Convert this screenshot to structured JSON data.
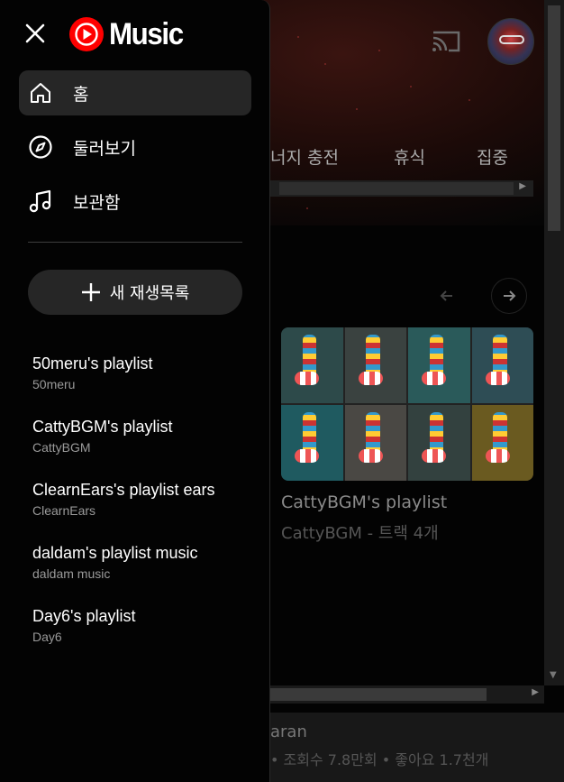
{
  "brand": {
    "logo_text": "Music",
    "accent": "#ff0000"
  },
  "nav": [
    {
      "label": "홈",
      "icon": "home-icon",
      "active": true
    },
    {
      "label": "둘러보기",
      "icon": "compass-icon",
      "active": false
    },
    {
      "label": "보관함",
      "icon": "music-note-icon",
      "active": false
    }
  ],
  "new_playlist_label": "새 재생목록",
  "playlists": [
    {
      "title": "50meru's playlist",
      "owner": "50meru"
    },
    {
      "title": "CattyBGM's playlist",
      "owner": "CattyBGM"
    },
    {
      "title": "ClearnEars's playlist ears",
      "owner": "ClearnEars"
    },
    {
      "title": "daldam's playlist music",
      "owner": "daldam music"
    },
    {
      "title": "Day6's playlist",
      "owner": "Day6"
    }
  ],
  "background": {
    "chips": [
      "너지 충전",
      "휴식",
      "집중"
    ],
    "card": {
      "title": "CattyBGM's playlist",
      "subtitle": "CattyBGM - 트랙 4개"
    },
    "bottom": {
      "title": "aran",
      "subtitle": "• 조회수 7.8만회 • 좋아요 1.7천개"
    }
  }
}
